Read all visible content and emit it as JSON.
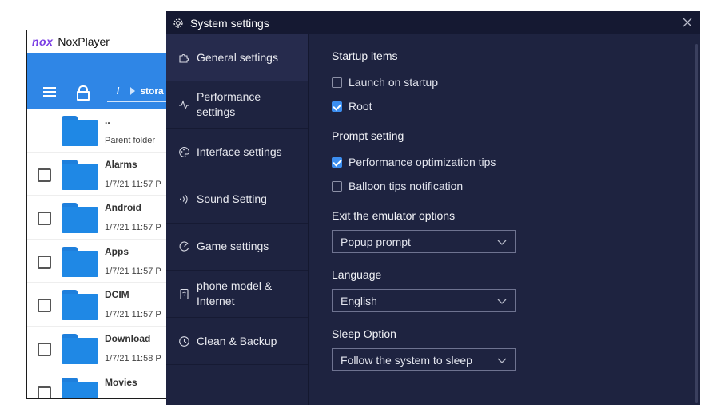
{
  "nox": {
    "app_name": "NoxPlayer",
    "logo_text": "nox",
    "path_slash": "/",
    "path_segment": "stora",
    "files": [
      {
        "name": "..",
        "date": "Parent folder",
        "checkbox": false
      },
      {
        "name": "Alarms",
        "date": "1/7/21 11:57 P",
        "checkbox": true
      },
      {
        "name": "Android",
        "date": "1/7/21 11:57 P",
        "checkbox": true
      },
      {
        "name": "Apps",
        "date": "1/7/21 11:57 P",
        "checkbox": true
      },
      {
        "name": "DCIM",
        "date": "1/7/21 11:57 P",
        "checkbox": true
      },
      {
        "name": "Download",
        "date": "1/7/21 11:58 P",
        "checkbox": true
      },
      {
        "name": "Movies",
        "date": "",
        "checkbox": true
      }
    ]
  },
  "dialog": {
    "title": "System settings",
    "nav": [
      {
        "label": "General settings",
        "icon": "puzzle-icon",
        "active": true
      },
      {
        "label": "Performance settings",
        "icon": "pulse-icon",
        "active": false
      },
      {
        "label": "Interface settings",
        "icon": "palette-icon",
        "active": false
      },
      {
        "label": "Sound Setting",
        "icon": "sound-icon",
        "active": false
      },
      {
        "label": "Game settings",
        "icon": "game-icon",
        "active": false
      },
      {
        "label": "phone model & Internet",
        "icon": "phone-icon",
        "active": false
      },
      {
        "label": "Clean & Backup",
        "icon": "clock-icon",
        "active": false
      }
    ],
    "startup": {
      "title": "Startup items",
      "launch_label": "Launch on startup",
      "launch_checked": false,
      "root_label": "Root",
      "root_checked": true
    },
    "prompt": {
      "title": "Prompt setting",
      "perf_label": "Performance optimization tips",
      "perf_checked": true,
      "balloon_label": "Balloon tips notification",
      "balloon_checked": false
    },
    "exit": {
      "title": "Exit the emulator options",
      "value": "Popup prompt"
    },
    "language": {
      "title": "Language",
      "value": "English"
    },
    "sleep": {
      "title": "Sleep Option",
      "value": "Follow the system to sleep"
    }
  },
  "colors": {
    "accent": "#3c8ef0",
    "dialog_bg": "#1e2340",
    "nox_blue": "#2f86e6"
  }
}
